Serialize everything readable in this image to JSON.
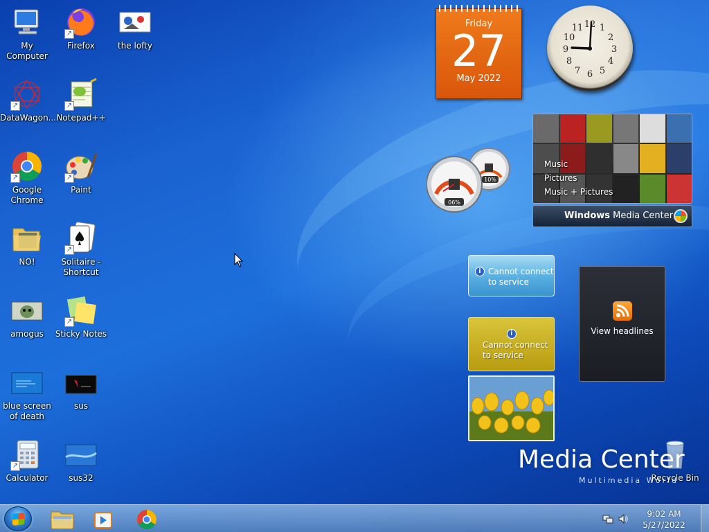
{
  "desktop": {
    "icons": [
      {
        "label": "My Computer"
      },
      {
        "label": "Firefox"
      },
      {
        "label": "the lofty"
      },
      {
        "label": "DataWagon..."
      },
      {
        "label": "Notepad++"
      },
      {
        "label": "Google Chrome"
      },
      {
        "label": "Paint"
      },
      {
        "label": "NO!"
      },
      {
        "label": "Solitaire - Shortcut"
      },
      {
        "label": "amogus"
      },
      {
        "label": "Sticky Notes"
      },
      {
        "label": "blue screen of death"
      },
      {
        "label": "sus"
      },
      {
        "label": "Calculator"
      },
      {
        "label": "sus32"
      },
      {
        "label": "Recycle Bin"
      }
    ]
  },
  "gadgets": {
    "calendar": {
      "weekday": "Friday",
      "day": "27",
      "month_year": "May 2022"
    },
    "clock": {
      "hour": 9,
      "minute": 2
    },
    "cpu_meter": {
      "cpu": "06%",
      "memory": "10%"
    },
    "media_center": {
      "menu": [
        "Music",
        "Pictures",
        "Music + Pictures"
      ],
      "bar_bold": "Windows",
      "bar_rest": " Media Center"
    },
    "weather": {
      "message": "Cannot connect to service"
    },
    "currency": {
      "message": "Cannot connect to service"
    },
    "feed": {
      "label": "View headlines"
    }
  },
  "branding": {
    "title": "Media Center",
    "subtitle": "Multimedia World"
  },
  "taskbar": {
    "time": "9:02 AM",
    "date": "5/27/2022",
    "pinned": [
      "explorer-icon",
      "media-player-icon",
      "chrome-icon"
    ]
  },
  "colors": {
    "calendar_orange": "#e2660f",
    "desktop_blue": "#1a63d1",
    "taskbar": "#7aa6d6"
  }
}
